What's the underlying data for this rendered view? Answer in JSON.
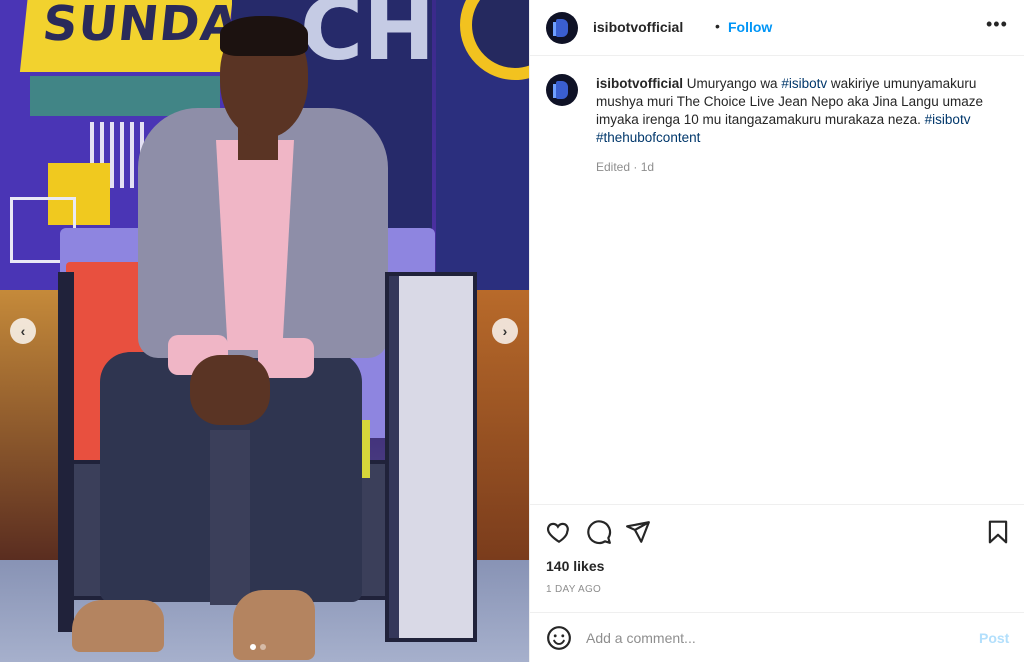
{
  "photo": {
    "banner_text": "SUNDAY",
    "backdrop_letters": "CH",
    "nav_prev_label": "‹",
    "nav_next_label": "›",
    "carousel_dots": 2,
    "active_dot": 0
  },
  "header": {
    "username": "isibotvofficial",
    "separator": "•",
    "follow_label": "Follow",
    "more_label": "•••"
  },
  "caption": {
    "username": "isibotvofficial",
    "text_1": "Umuryango wa ",
    "hashtag_1": "#isibotv",
    "text_2": " wakiriye umunyamakuru mushya muri The Choice Live Jean Nepo aka Jina Langu umaze imyaka irenga 10 mu itangazamakuru murakaza neza. ",
    "hashtag_2": "#isibotv",
    "hashtag_3": "#thehubofcontent",
    "meta": "Edited · 1d"
  },
  "actions": {
    "icons": [
      "heart-icon",
      "comment-icon",
      "share-icon",
      "bookmark-icon"
    ]
  },
  "stats": {
    "likes": "140 likes",
    "time_ago": "1 DAY AGO"
  },
  "comment": {
    "placeholder": "Add a comment...",
    "post_label": "Post"
  },
  "colors": {
    "link_blue": "#0095f6",
    "hashtag_blue": "#00376b",
    "muted": "#8e8e8e",
    "post_disabled": "#b2dffc"
  }
}
